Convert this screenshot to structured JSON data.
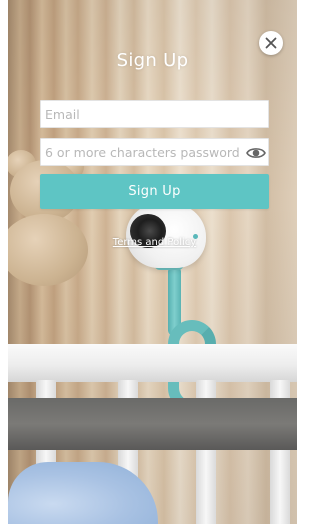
{
  "form": {
    "title": "Sign Up",
    "email_placeholder": "Email",
    "email_value": "",
    "password_placeholder": "6 or more characters password",
    "password_value": "",
    "submit_label": "Sign Up",
    "terms_label": "Terms and Policy"
  },
  "icons": {
    "close": "close-icon",
    "password_toggle": "eye-icon"
  },
  "colors": {
    "accent": "#5ec5c4",
    "title_text": "#ffffff",
    "field_background": "#ffffff",
    "placeholder_text": "#b8b8b8"
  }
}
